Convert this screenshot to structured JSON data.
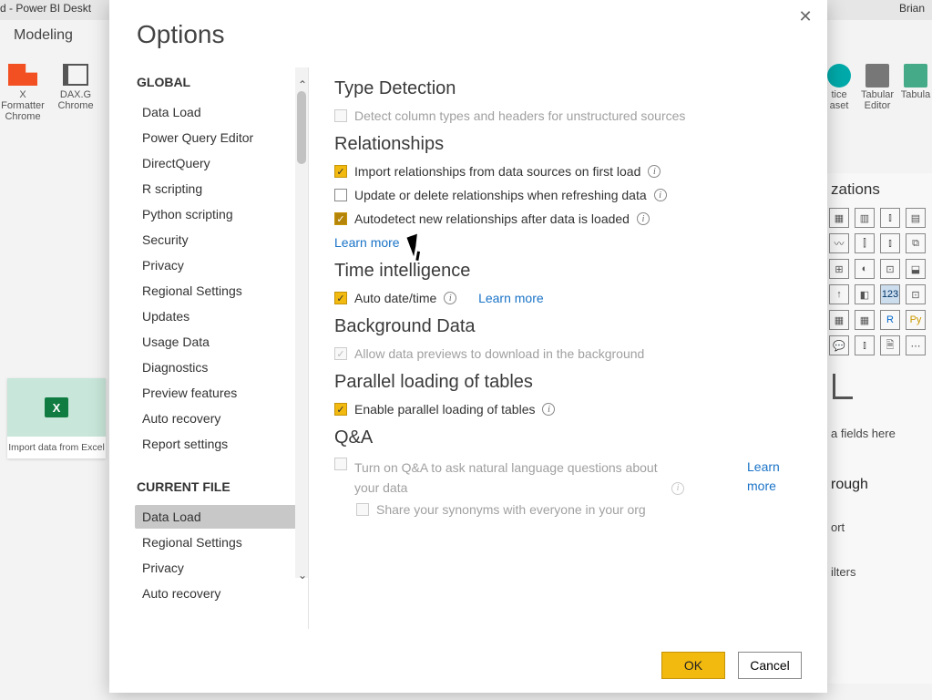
{
  "app": {
    "title_left": "d - Power BI Deskt",
    "title_right": "Brian",
    "ribbon_tab": "Modeling",
    "ribbon_items": [
      {
        "label": "X Formatter",
        "sub": "Chrome"
      },
      {
        "label": "DAX.G",
        "sub": "Chrome"
      }
    ],
    "right_ribbon": [
      {
        "label": "tice",
        "sub": "aset"
      },
      {
        "label": "Tabular",
        "sub": "Editor"
      },
      {
        "label": "Tabula",
        "sub": ""
      }
    ],
    "excel_card": "Import data from Excel"
  },
  "viz": {
    "title": "zations",
    "drill_label": "rough",
    "fields_hint": "a fields here",
    "report_radio": "ort",
    "filters": "ilters"
  },
  "dialog": {
    "title": "Options",
    "ok": "OK",
    "cancel": "Cancel",
    "sidebar": {
      "global_header": "GLOBAL",
      "global": [
        "Data Load",
        "Power Query Editor",
        "DirectQuery",
        "R scripting",
        "Python scripting",
        "Security",
        "Privacy",
        "Regional Settings",
        "Updates",
        "Usage Data",
        "Diagnostics",
        "Preview features",
        "Auto recovery",
        "Report settings"
      ],
      "current_header": "CURRENT FILE",
      "current": [
        "Data Load",
        "Regional Settings",
        "Privacy",
        "Auto recovery"
      ],
      "current_selected": 0
    },
    "content": {
      "type_detection": {
        "title": "Type Detection",
        "opt1": "Detect column types and headers for unstructured sources"
      },
      "relationships": {
        "title": "Relationships",
        "opt1": "Import relationships from data sources on first load",
        "opt2": "Update or delete relationships when refreshing data",
        "opt3": "Autodetect new relationships after data is loaded",
        "learn": "Learn more"
      },
      "time_intel": {
        "title": "Time intelligence",
        "opt1": "Auto date/time",
        "learn": "Learn more"
      },
      "background": {
        "title": "Background Data",
        "opt1": "Allow data previews to download in the background"
      },
      "parallel": {
        "title": "Parallel loading of tables",
        "opt1": "Enable parallel loading of tables"
      },
      "qa": {
        "title": "Q&A",
        "opt1": "Turn on Q&A to ask natural language questions about your data",
        "opt2": "Share your synonyms with everyone in your org",
        "learn": "Learn more"
      }
    }
  }
}
